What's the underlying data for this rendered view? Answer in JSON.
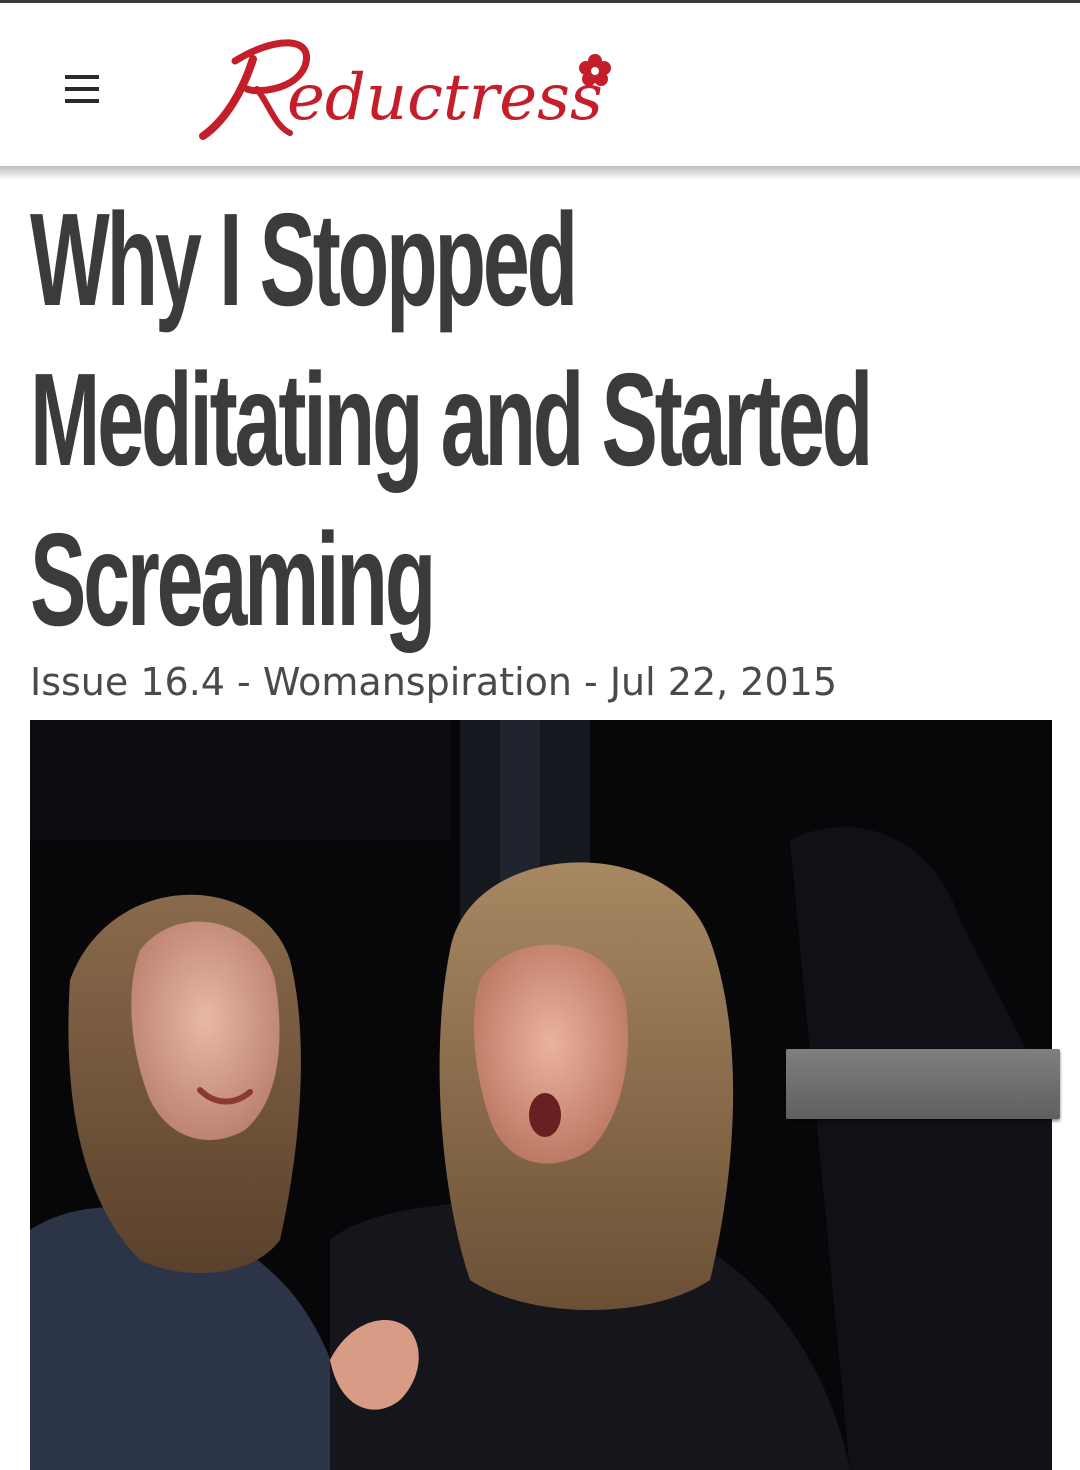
{
  "site": {
    "logo_text": "Reductress",
    "logo_color": "#c41e2a"
  },
  "article": {
    "headline_lines": [
      "Why I Stopped",
      "Meditating and Started",
      "Screaming"
    ],
    "meta": "Issue 16.4 - Womanspiration - Jul 22, 2015"
  },
  "icons": {
    "menu": "hamburger-menu-icon",
    "logo_flower": "flower-icon"
  }
}
